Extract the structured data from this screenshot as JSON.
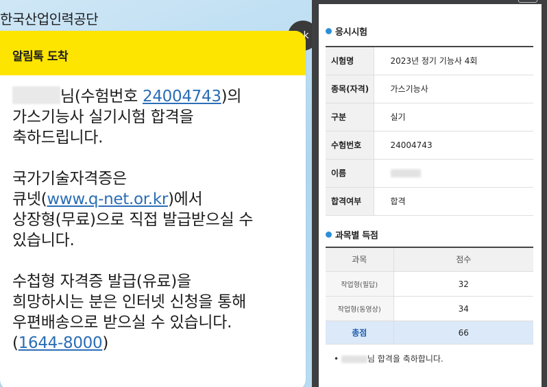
{
  "kakao": {
    "sender": "한국산업인력공단",
    "chip_label": "kak",
    "header": "알림톡 도착",
    "line1_suffix": "님(수험번호 ",
    "exam_no": "24004743",
    "line1_end": ")의",
    "line2": "가스기능사 실기시험 합격을",
    "line3": "축하드립니다.",
    "p2_line1": "국가기술자격증은",
    "p2_prefix": "큐넷(",
    "p2_link": "www.q-net.or.kr",
    "p2_suffix": ")에서",
    "p2_line3": "상장형(무료)으로 직접 발급받으실 수",
    "p2_line4": "있습니다.",
    "p3_line1": "수첩형 자격증 발급(유료)을",
    "p3_line2": "희망하시는 분은 인터넷 신청을 통해",
    "p3_line3": "우편배송으로 받으실 수 있습니다.",
    "p3_open": "(",
    "phone": "1644-8000",
    "p3_close": ")"
  },
  "result": {
    "section1_title": "응시시험",
    "rows": [
      {
        "label": "시험명",
        "value": "2023년 정기 기능사 4회"
      },
      {
        "label": "종목(자격)",
        "value": "가스기능사"
      },
      {
        "label": "구분",
        "value": "실기"
      },
      {
        "label": "수험번호",
        "value": "24004743"
      },
      {
        "label": "이름",
        "value": ""
      },
      {
        "label": "합격여부",
        "value": "합격"
      }
    ],
    "section2_title": "과목별 득점",
    "score_headers": [
      "과목",
      "점수"
    ],
    "scores": [
      {
        "subject": "작업형(필답)",
        "score": "32"
      },
      {
        "subject": "작업형(동영상)",
        "score": "34"
      }
    ],
    "total_label": "총점",
    "total_score": "66",
    "congrats_bullet": "•",
    "congrats_text": "님 합격을 축하합니다."
  },
  "colors": {
    "kakao_yellow": "#fee500",
    "link_blue": "#2a6db6",
    "qnet_dot_blue": "#2b8fd8",
    "total_row_bg": "#dbe9f8"
  }
}
